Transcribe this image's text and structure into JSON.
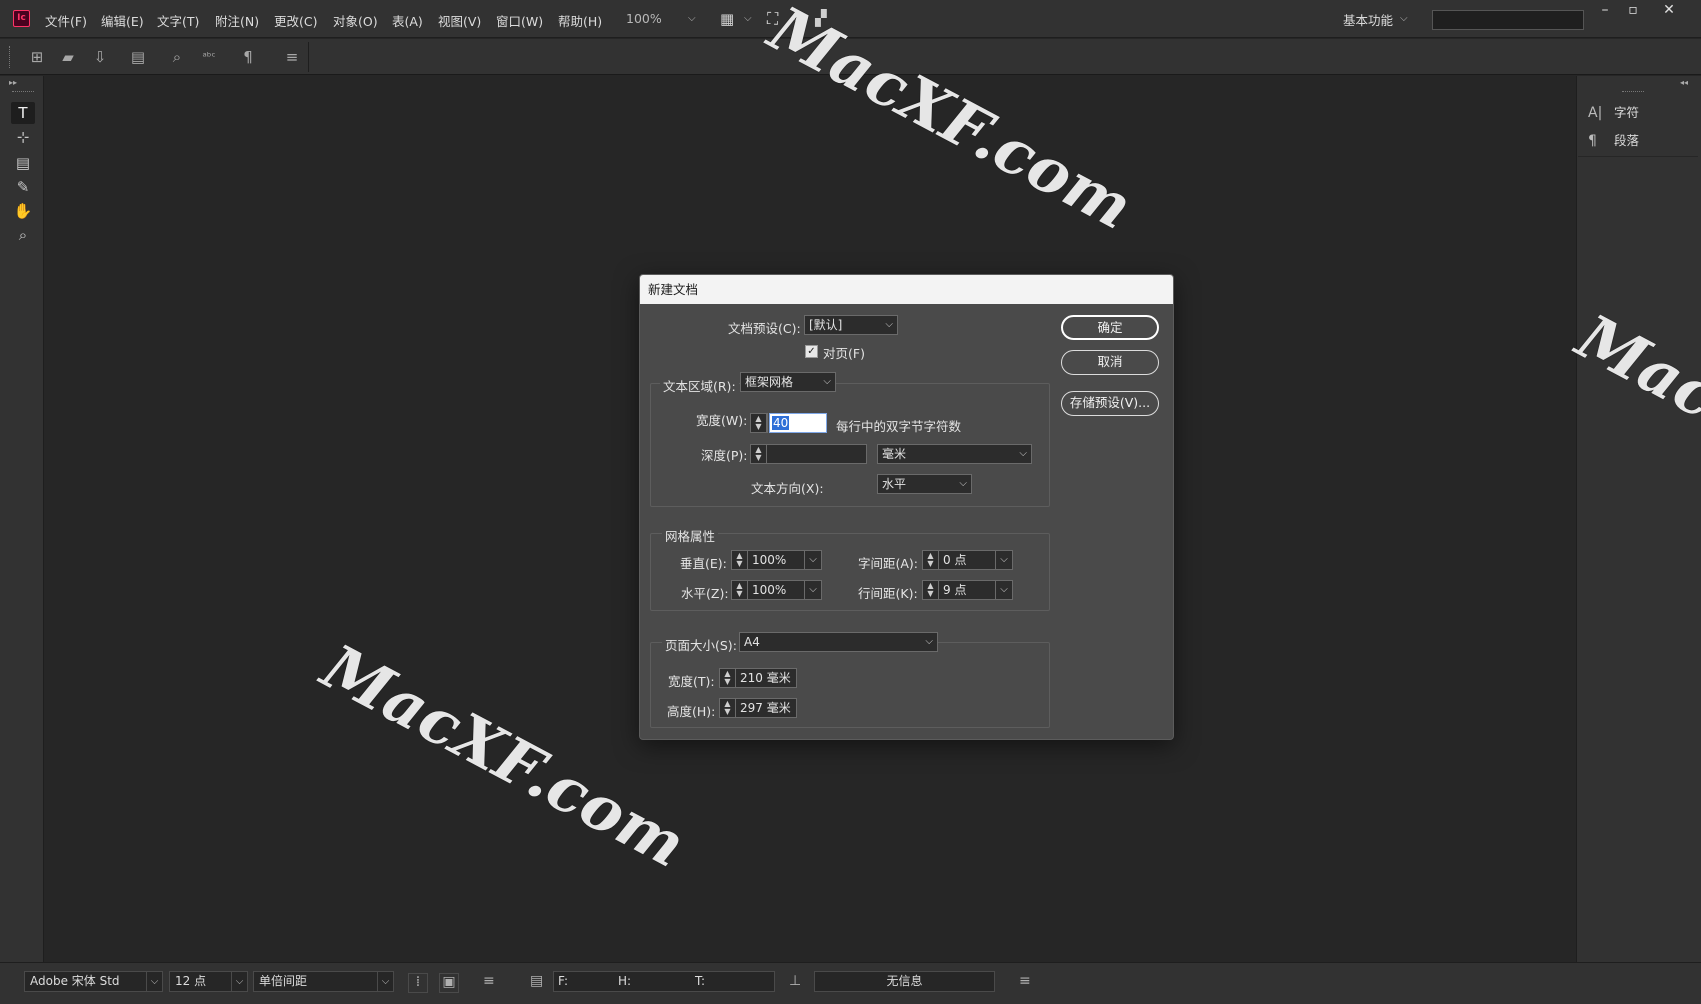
{
  "app": {
    "logo_text": "Ic",
    "menus": [
      "文件(F)",
      "编辑(E)",
      "文字(T)",
      "附注(N)",
      "更改(C)",
      "对象(O)",
      "表(A)",
      "视图(V)",
      "窗口(W)",
      "帮助(H)"
    ],
    "zoom": "100%",
    "workspace": "基本功能",
    "window_controls": {
      "minimize": "–",
      "maximize": "▫",
      "close": "✕"
    }
  },
  "right_panel": {
    "items": [
      {
        "icon": "character-icon",
        "label": "字符"
      },
      {
        "icon": "paragraph-icon",
        "label": "段落"
      }
    ]
  },
  "dialog": {
    "title": "新建文档",
    "preset_label": "文档预设(C):",
    "preset_value": "[默认]",
    "facing_pages_label": "对页(F)",
    "facing_pages_checked": true,
    "text_area_label": "文本区域(R):",
    "text_area_value": "框架网格",
    "width_label": "宽度(W):",
    "width_value": "40",
    "width_unit_text": "每行中的双字节字符数",
    "depth_label": "深度(P):",
    "depth_value": "",
    "depth_unit": "毫米",
    "direction_label": "文本方向(X):",
    "direction_value": "水平",
    "grid_section": "网格属性",
    "vertical_label": "垂直(E):",
    "vertical_value": "100%",
    "horizontal_label": "水平(Z):",
    "horizontal_value": "100%",
    "char_spacing_label": "字间距(A):",
    "char_spacing_value": "0 点",
    "line_spacing_label": "行间距(K):",
    "line_spacing_value": "9 点",
    "page_size_label": "页面大小(S):",
    "page_size_value": "A4",
    "page_width_label": "宽度(T):",
    "page_width_value": "210 毫米",
    "page_height_label": "高度(H):",
    "page_height_value": "297 毫米",
    "ok_label": "确定",
    "cancel_label": "取消",
    "save_preset_label": "存储预设(V)..."
  },
  "status_bar": {
    "font": "Adobe 宋体 Std",
    "size": "12 点",
    "spacing": "单倍间距",
    "f_label": "F:",
    "h_label": "H:",
    "t_label": "T:",
    "info": "无信息"
  },
  "watermark": {
    "text": "MacXF.com",
    "partial_right": "Mac"
  }
}
